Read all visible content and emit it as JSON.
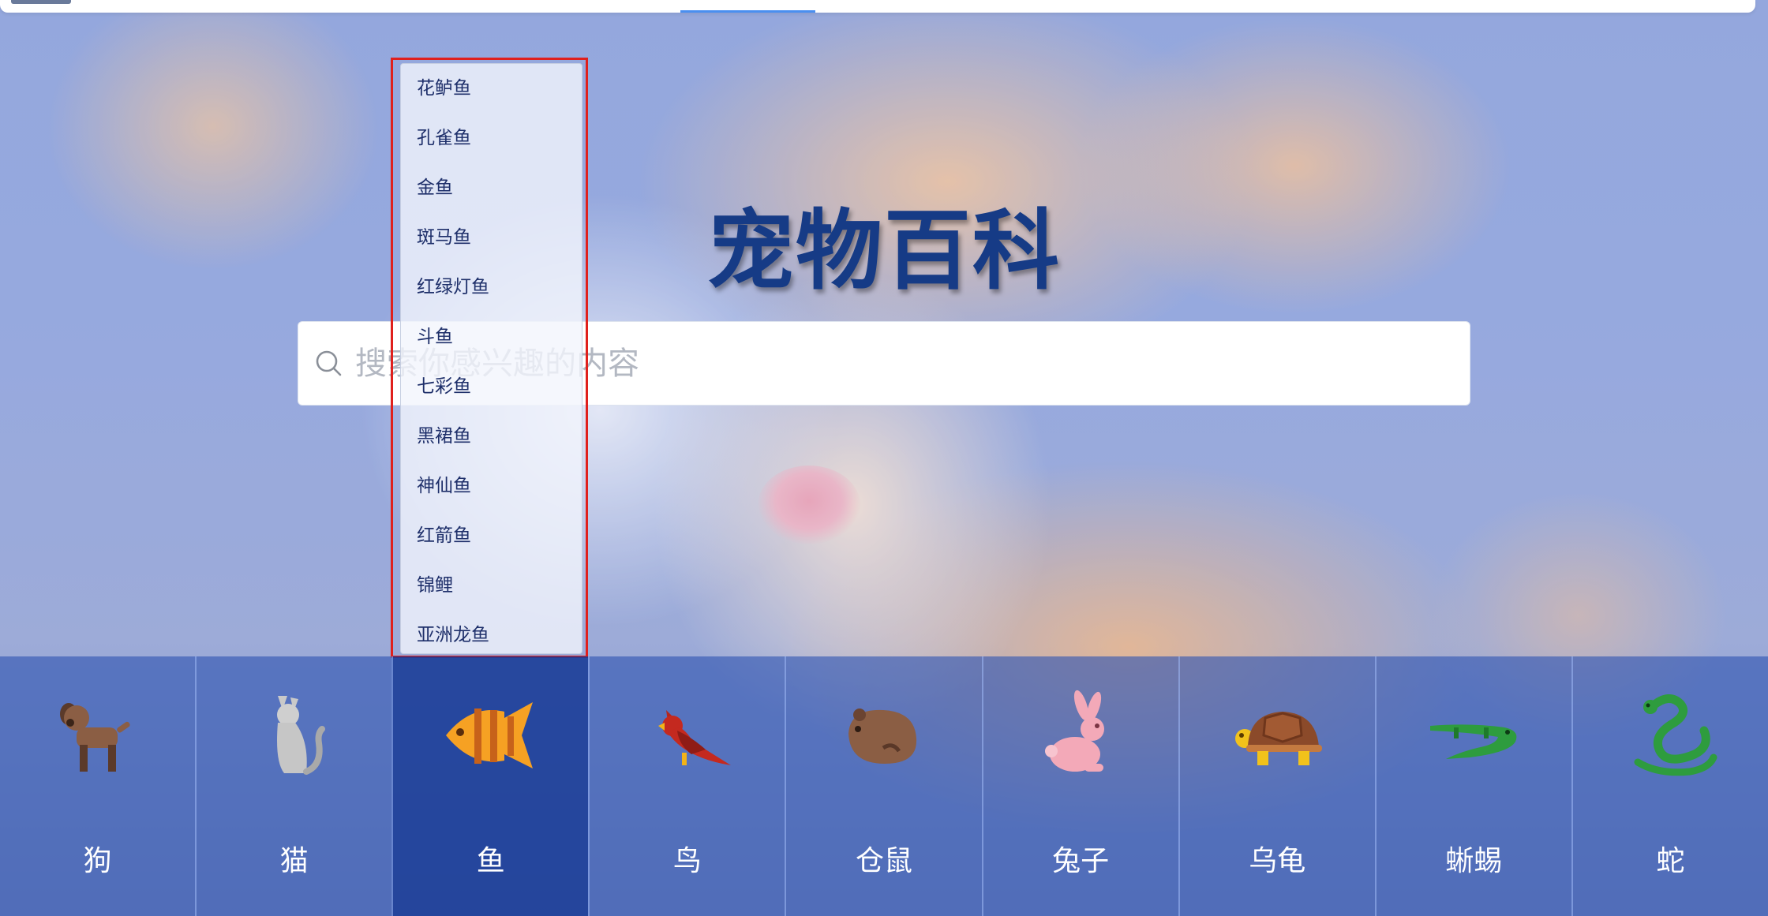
{
  "site": {
    "title": "宠物百科"
  },
  "search": {
    "placeholder": "搜索你感兴趣的内容",
    "value": ""
  },
  "dropdown": {
    "items": [
      "花鲈鱼",
      "孔雀鱼",
      "金鱼",
      "斑马鱼",
      "红绿灯鱼",
      "斗鱼",
      "七彩鱼",
      "黑裙鱼",
      "神仙鱼",
      "红箭鱼",
      "锦鲤",
      "亚洲龙鱼"
    ]
  },
  "categories": [
    {
      "label": "狗",
      "icon": "dog-icon"
    },
    {
      "label": "猫",
      "icon": "cat-icon"
    },
    {
      "label": "鱼",
      "icon": "fish-icon",
      "active": true
    },
    {
      "label": "鸟",
      "icon": "bird-icon"
    },
    {
      "label": "仓鼠",
      "icon": "hamster-icon"
    },
    {
      "label": "兔子",
      "icon": "rabbit-icon"
    },
    {
      "label": "乌龟",
      "icon": "turtle-icon"
    },
    {
      "label": "蜥蜴",
      "icon": "lizard-icon"
    },
    {
      "label": "蛇",
      "icon": "snake-icon"
    }
  ],
  "colors": {
    "title": "#163b86",
    "category_bar": "#2f54b2",
    "category_active": "#173a96",
    "dropdown_highlight": "#e0201c",
    "top_tab_indicator": "#4a8ff0"
  }
}
